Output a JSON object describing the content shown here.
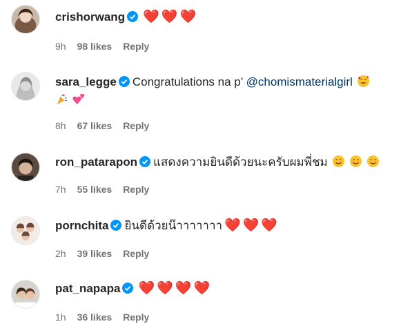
{
  "comments": [
    {
      "username": "crishorwang",
      "text": "",
      "hearts": [
        "❤️",
        "❤️",
        "❤️"
      ],
      "time": "9h",
      "likes": "98 likes",
      "reply_label": "Reply"
    },
    {
      "username": "sara_legge",
      "text": "Congratulations na p’",
      "mention": "@chomismaterialgirl",
      "emojis": [
        "smiling-face-with-hearts",
        "party-popper",
        "two-hearts"
      ],
      "time": "8h",
      "likes": "67 likes",
      "reply_label": "Reply"
    },
    {
      "username": "ron_patarapon",
      "text": "แสดงความยินดีด้วยนะครับผมพี่ชม",
      "emojis": [
        "smiling-face",
        "smiling-face",
        "smiling-face"
      ],
      "time": "7h",
      "likes": "55 likes",
      "reply_label": "Reply"
    },
    {
      "username": "pornchita",
      "text": "ยินดีด้วยน๊าาาาาาา",
      "hearts": [
        "❤️",
        "❤️",
        "❤️"
      ],
      "time": "2h",
      "likes": "39 likes",
      "reply_label": "Reply"
    },
    {
      "username": "pat_napapa",
      "text": "",
      "hearts": [
        "❤️",
        "❤️",
        "❤️",
        "❤️"
      ],
      "time": "1h",
      "likes": "36 likes",
      "reply_label": "Reply"
    }
  ],
  "colors": {
    "verified": "#0095f6",
    "heart": "#e0182d",
    "meta": "#737373",
    "mention": "#00376b"
  }
}
